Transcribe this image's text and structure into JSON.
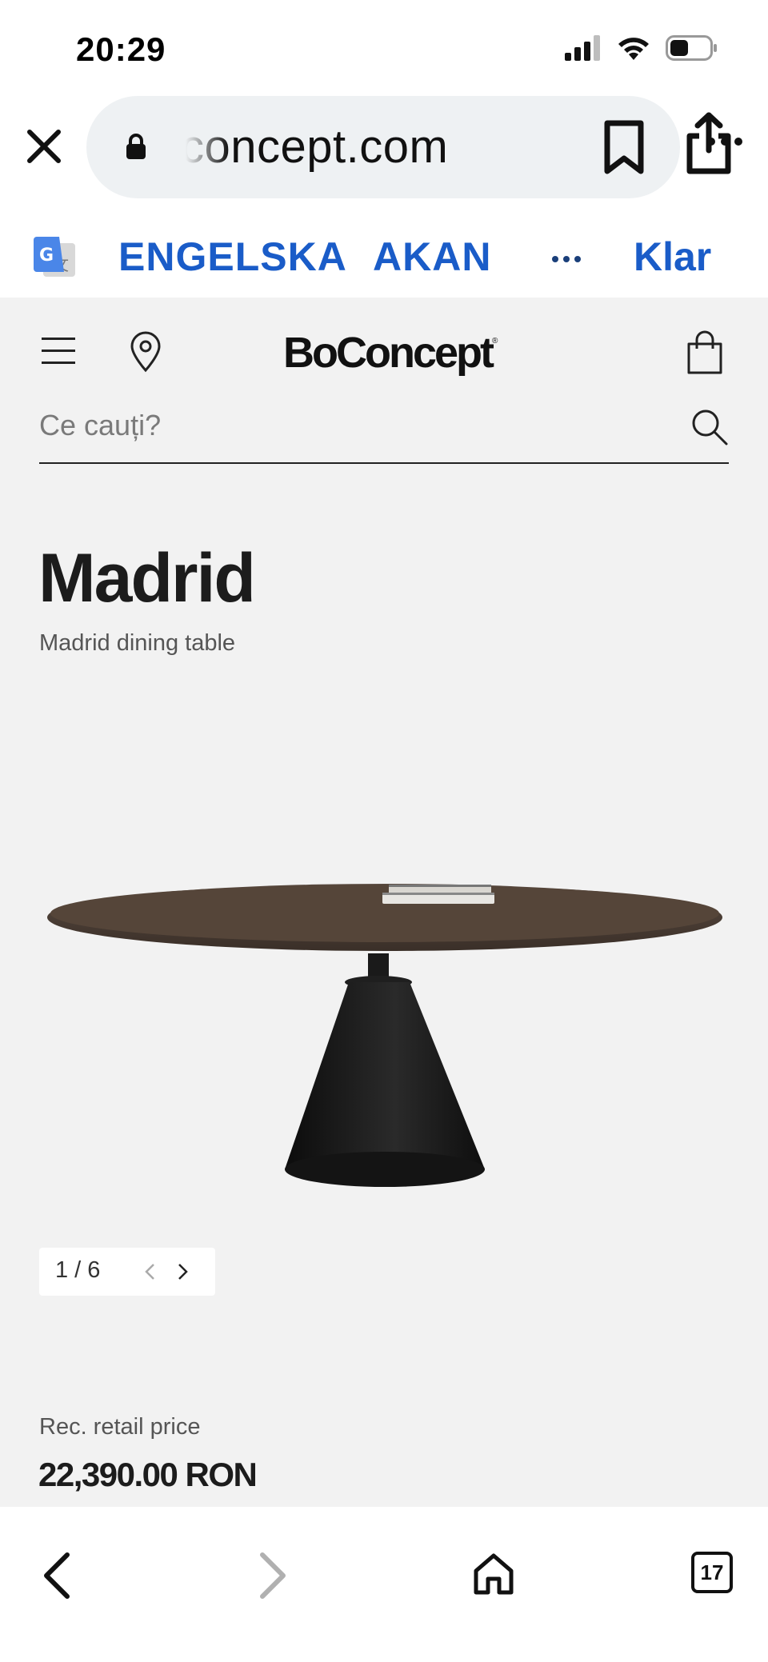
{
  "status_bar": {
    "time": "20:29"
  },
  "browser": {
    "url": "concept.com",
    "icons": [
      "close-icon",
      "lock-icon",
      "bookmark-icon",
      "share-icon",
      "more-icon"
    ]
  },
  "translate": {
    "tabs": [
      "ENGELSKA",
      "AKAN"
    ],
    "active_tab": "ENGELSKA",
    "done_label": "Klar",
    "accent_color": "#1a5cc8"
  },
  "site": {
    "logo": "BoConcept",
    "logo_mark": "®",
    "search": {
      "placeholder": "Ce cauți?"
    },
    "product": {
      "name": "Madrid",
      "subtitle": "Madrid dining table",
      "pager": "1 / 6",
      "price_label": "Rec. retail price",
      "price": "22,390.00 RON"
    }
  },
  "bottom_nav": {
    "tab_count": "17"
  }
}
